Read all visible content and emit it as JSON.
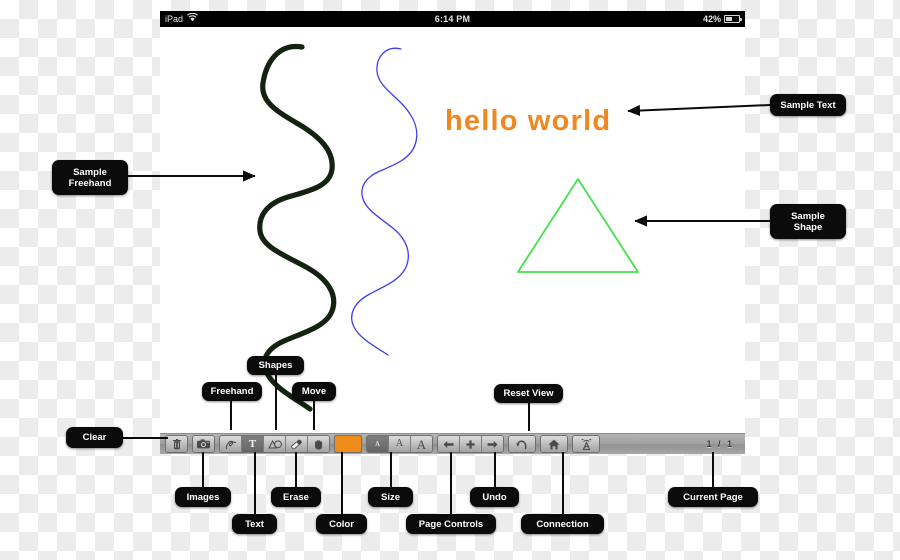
{
  "device": {
    "status_bar": {
      "carrier_label": "iPad",
      "wifi_icon": "wifi-icon",
      "time": "6:14 PM",
      "battery_percent": "42%",
      "battery_icon": "battery-icon"
    }
  },
  "canvas": {
    "text_object": {
      "value": "hello world",
      "color": "#f08822"
    },
    "shape_object": {
      "type": "triangle",
      "color": "#44e24a"
    },
    "freehand_strokes": [
      {
        "name": "dark-stroke",
        "color": "#13230f"
      },
      {
        "name": "blue-stroke",
        "color": "#3d3df0"
      }
    ]
  },
  "toolbar": {
    "buttons": [
      {
        "id": "clear",
        "icon": "trash-icon",
        "label": "Clear",
        "selected": false
      },
      {
        "id": "images",
        "icon": "camera-icon",
        "label": "Images",
        "selected": false
      },
      {
        "id": "freehand",
        "icon": "squiggle-icon",
        "label": "Freehand",
        "selected": false
      },
      {
        "id": "text",
        "icon": "text-t-icon",
        "label": "Text",
        "selected": true
      },
      {
        "id": "shapes",
        "icon": "shapes-icon",
        "label": "Shapes",
        "selected": false
      },
      {
        "id": "erase",
        "icon": "eraser-icon",
        "label": "Erase",
        "selected": false
      },
      {
        "id": "move",
        "icon": "hand-icon",
        "label": "Move",
        "selected": false
      },
      {
        "id": "color",
        "icon": "color-swatch",
        "label": "Color",
        "selected": false
      },
      {
        "id": "size-small",
        "icon": "letter-a-small",
        "label": "Size",
        "selected": true
      },
      {
        "id": "size-med",
        "icon": "letter-a-med",
        "label": "Size",
        "selected": false
      },
      {
        "id": "size-large",
        "icon": "letter-a-large",
        "label": "Size",
        "selected": false
      },
      {
        "id": "page-prev",
        "icon": "arrow-left-icon",
        "label": "Page Controls",
        "selected": false
      },
      {
        "id": "page-add",
        "icon": "plus-icon",
        "label": "Page Controls",
        "selected": false
      },
      {
        "id": "page-next",
        "icon": "arrow-right-icon",
        "label": "Page Controls",
        "selected": false
      },
      {
        "id": "undo",
        "icon": "undo-arrow-icon",
        "label": "Undo",
        "selected": false
      },
      {
        "id": "reset-view",
        "icon": "home-icon",
        "label": "Reset View",
        "selected": false
      },
      {
        "id": "connection",
        "icon": "broadcast-tower-icon",
        "label": "Connection",
        "selected": false
      }
    ],
    "color_swatch_value": "#ef8c1c",
    "size_letters": {
      "small": "A",
      "medium": "A",
      "large": "A"
    },
    "page_indicator": "1 / 1"
  },
  "annotations": {
    "sample_freehand": "Sample\nFreehand",
    "sample_text": "Sample Text",
    "sample_shape": "Sample\nShape",
    "clear": "Clear",
    "images": "Images",
    "freehand": "Freehand",
    "text": "Text",
    "shapes": "Shapes",
    "erase": "Erase",
    "move": "Move",
    "color": "Color",
    "size": "Size",
    "page_controls": "Page Controls",
    "undo": "Undo",
    "reset_view": "Reset View",
    "connection": "Connection",
    "current_page": "Current Page"
  }
}
